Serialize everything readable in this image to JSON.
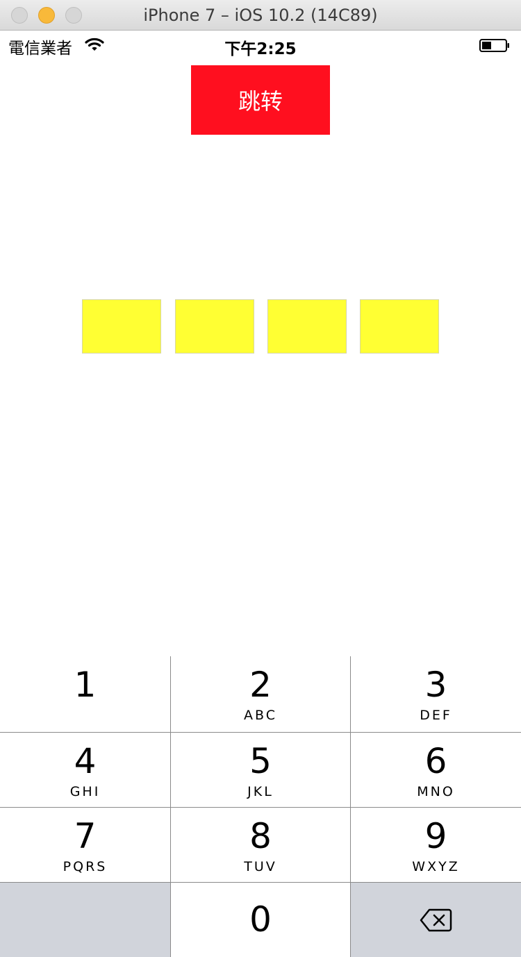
{
  "window": {
    "title": "iPhone 7 – iOS 10.2 (14C89)"
  },
  "status_bar": {
    "carrier": "電信業者",
    "time": "下午2:25",
    "icons": [
      "wifi-icon",
      "battery-icon"
    ]
  },
  "main": {
    "jump_button_label": "跳转",
    "jump_button_color": "#ff0f1f",
    "pin_box_count": 4,
    "pin_box_color": "#ffff33"
  },
  "keypad": {
    "keys": [
      {
        "digit": "1",
        "letters": ""
      },
      {
        "digit": "2",
        "letters": "ABC"
      },
      {
        "digit": "3",
        "letters": "DEF"
      },
      {
        "digit": "4",
        "letters": "GHI"
      },
      {
        "digit": "5",
        "letters": "JKL"
      },
      {
        "digit": "6",
        "letters": "MNO"
      },
      {
        "digit": "7",
        "letters": "PQRS"
      },
      {
        "digit": "8",
        "letters": "TUV"
      },
      {
        "digit": "9",
        "letters": "WXYZ"
      },
      {
        "digit": "0",
        "letters": ""
      }
    ],
    "delete_icon": "backspace-icon"
  }
}
